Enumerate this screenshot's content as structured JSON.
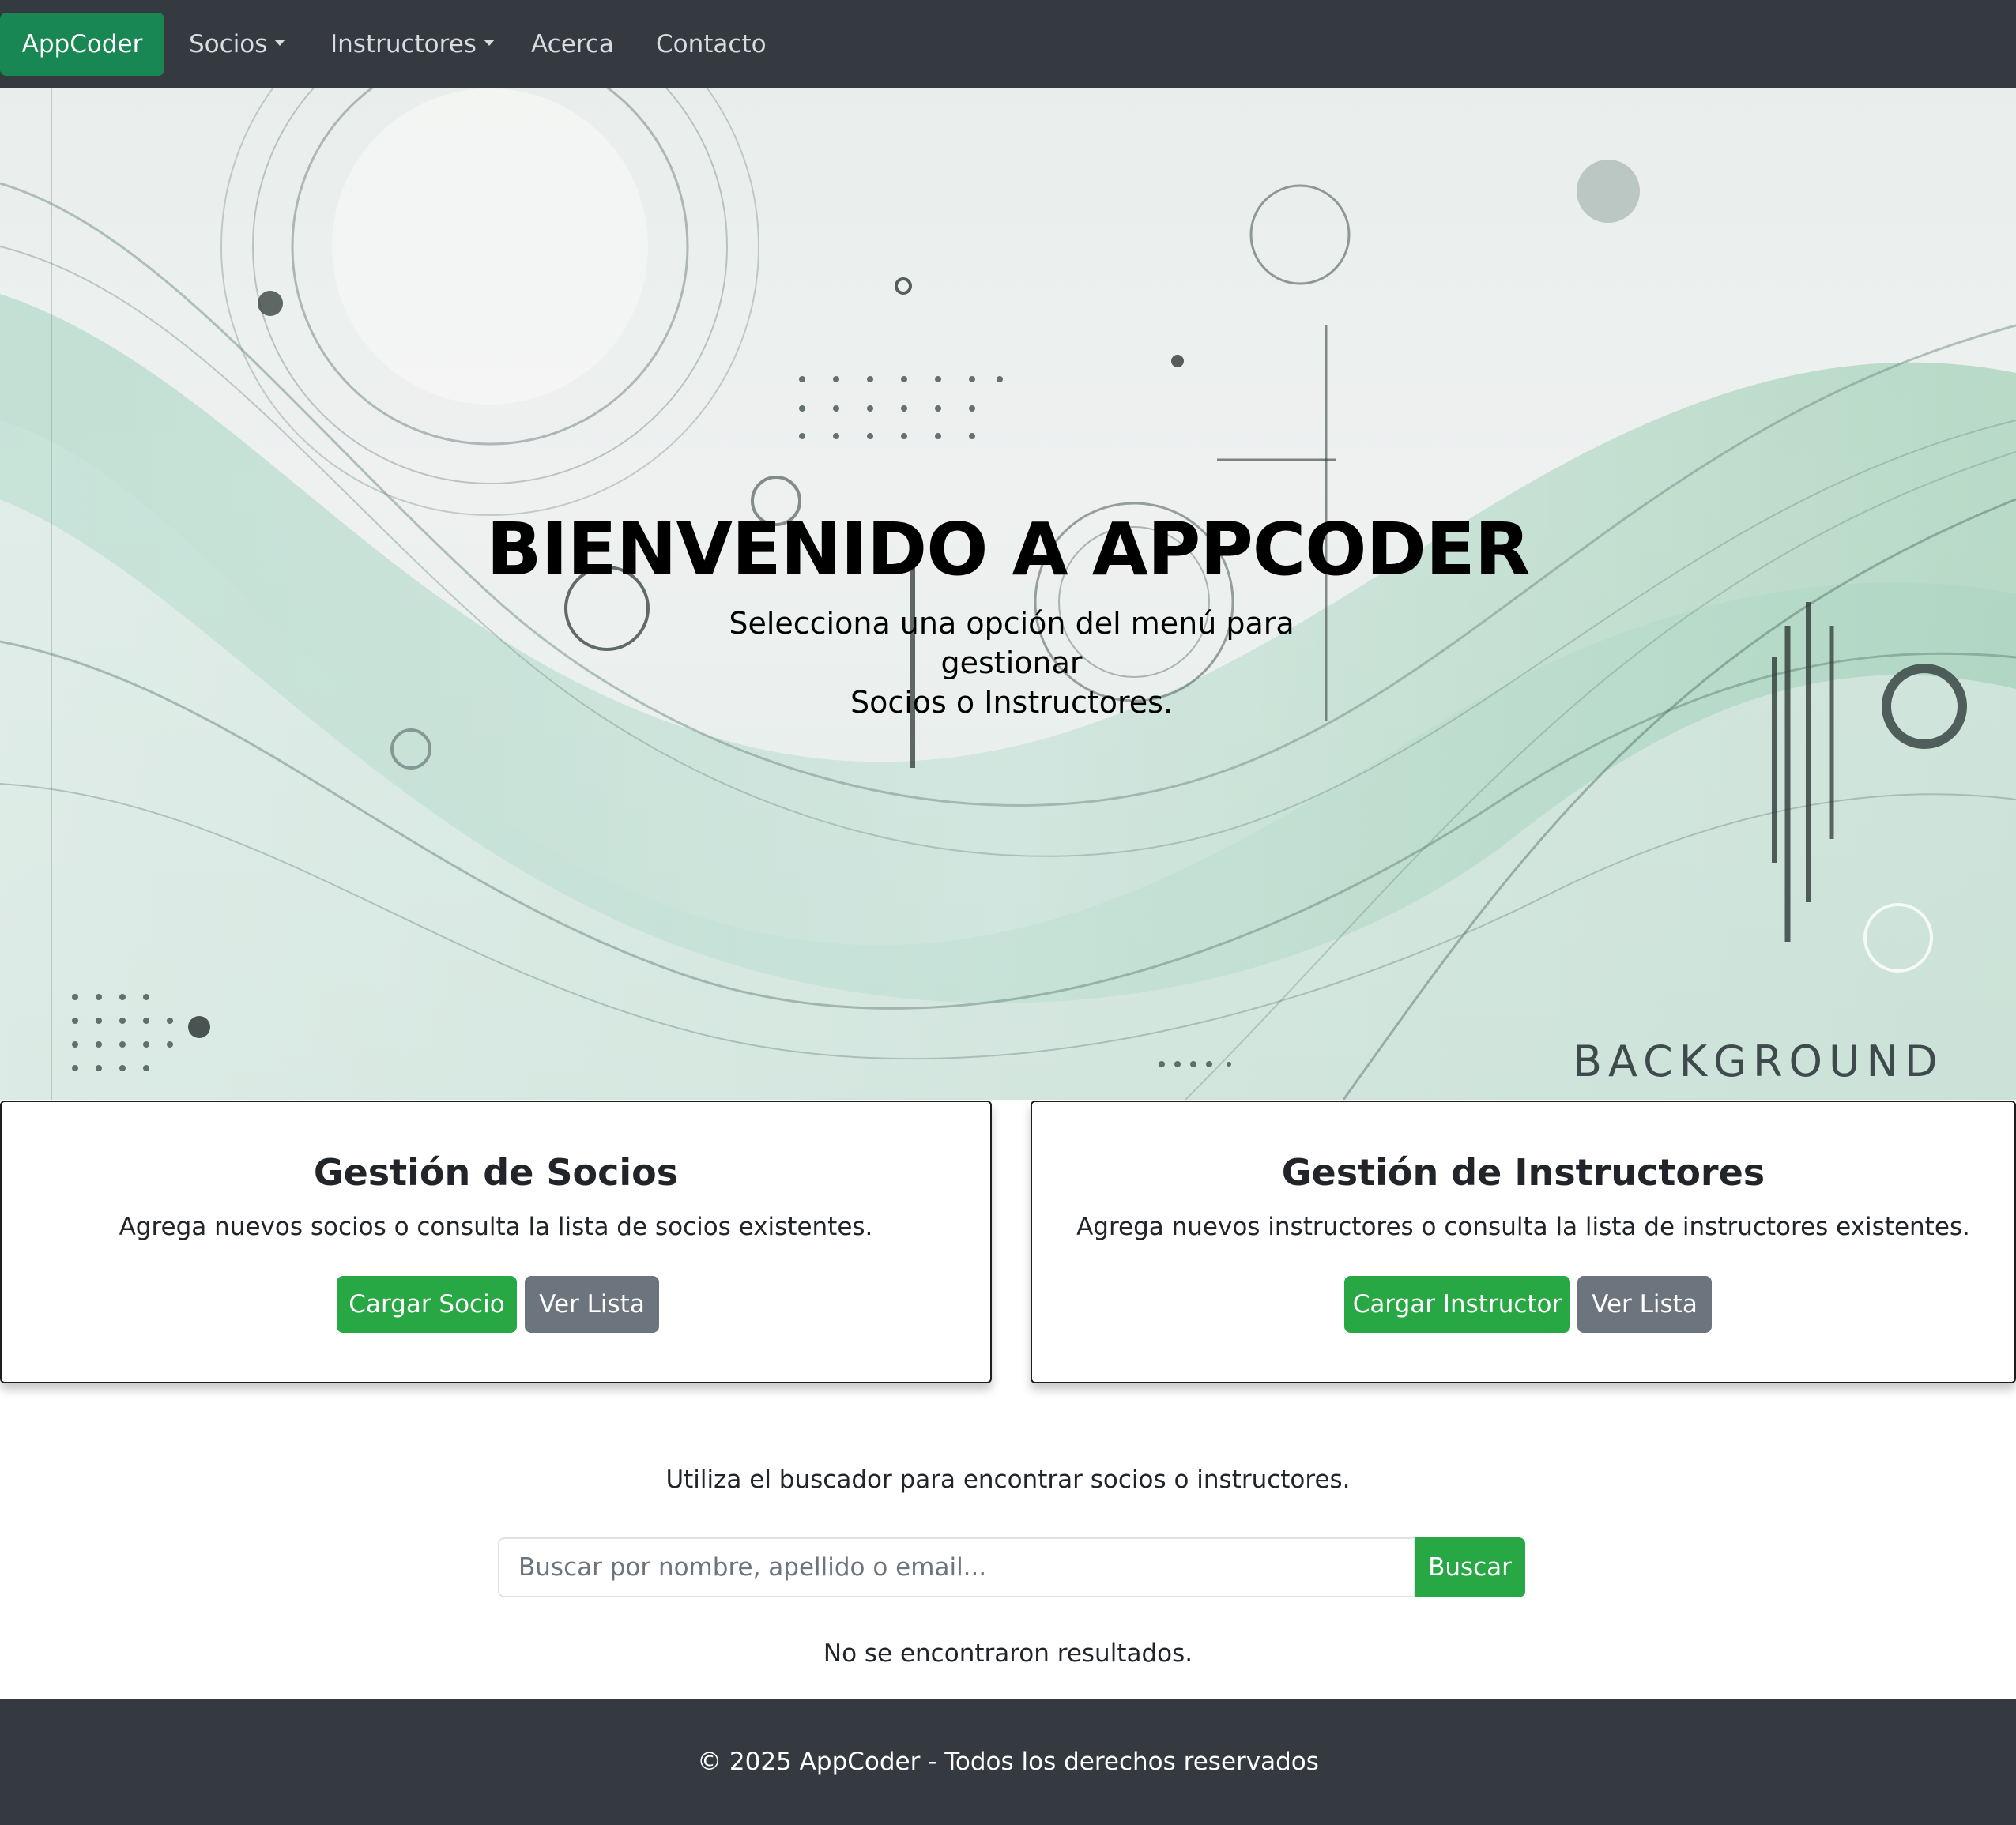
{
  "navbar": {
    "brand": "AppCoder",
    "items": [
      {
        "label": "Socios",
        "dropdown": true
      },
      {
        "label": "Instructores",
        "dropdown": true
      },
      {
        "label": "Acerca",
        "dropdown": false
      },
      {
        "label": "Contacto",
        "dropdown": false
      }
    ]
  },
  "hero": {
    "title": "BIENVENIDO A APPCODER",
    "subtitle_line1": "Selecciona una opción del menú para gestionar",
    "subtitle_line2": "Socios o Instructores.",
    "background_word": "BACKGROUND"
  },
  "cards": [
    {
      "title": "Gestión de Socios",
      "text": "Agrega nuevos socios o consulta la lista de socios existentes.",
      "primary_button": "Cargar Socio",
      "secondary_button": "Ver Lista"
    },
    {
      "title": "Gestión de Instructores",
      "text": "Agrega nuevos instructores o consulta la lista de instructores existentes.",
      "primary_button": "Cargar Instructor",
      "secondary_button": "Ver Lista"
    }
  ],
  "search": {
    "hint": "Utiliza el buscador para encontrar socios o instructores.",
    "placeholder": "Buscar por nombre, apellido o email...",
    "value": "",
    "button": "Buscar",
    "no_results": "No se encontraron resultados."
  },
  "footer": {
    "text": "© 2025 AppCoder - Todos los derechos reservados"
  },
  "colors": {
    "navbar_bg": "#343a40",
    "brand_bg": "#198754",
    "primary_button": "#28a745",
    "secondary_button": "#6c757d"
  }
}
